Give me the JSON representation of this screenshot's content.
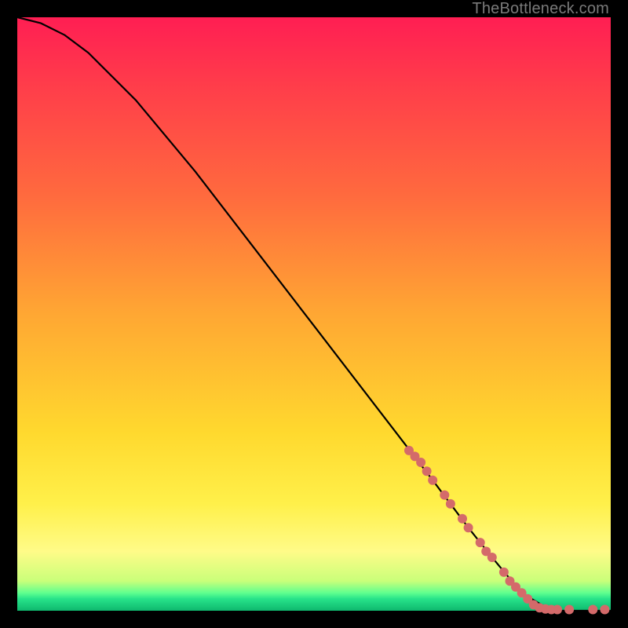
{
  "watermark": "TheBottleneck.com",
  "chart_data": {
    "type": "line",
    "title": "",
    "xlabel": "",
    "ylabel": "",
    "xlim": [
      0,
      100
    ],
    "ylim": [
      0,
      100
    ],
    "grid": false,
    "legend": false,
    "series": [
      {
        "name": "curve",
        "x": [
          0,
          4,
          8,
          12,
          16,
          20,
          30,
          40,
          50,
          60,
          70,
          76,
          80,
          85,
          90,
          95,
          100
        ],
        "y": [
          100,
          99,
          97,
          94,
          90,
          86,
          74,
          61,
          48,
          35,
          22,
          14,
          9,
          3,
          0,
          0,
          0
        ]
      }
    ],
    "markers": [
      {
        "x": 66,
        "y": 27
      },
      {
        "x": 67,
        "y": 26
      },
      {
        "x": 68,
        "y": 25
      },
      {
        "x": 69,
        "y": 23.5
      },
      {
        "x": 70,
        "y": 22
      },
      {
        "x": 72,
        "y": 19.5
      },
      {
        "x": 73,
        "y": 18
      },
      {
        "x": 75,
        "y": 15.5
      },
      {
        "x": 76,
        "y": 14
      },
      {
        "x": 78,
        "y": 11.5
      },
      {
        "x": 79,
        "y": 10
      },
      {
        "x": 80,
        "y": 9
      },
      {
        "x": 82,
        "y": 6.5
      },
      {
        "x": 83,
        "y": 5
      },
      {
        "x": 84,
        "y": 4
      },
      {
        "x": 85,
        "y": 3
      },
      {
        "x": 86,
        "y": 2
      },
      {
        "x": 87,
        "y": 1
      },
      {
        "x": 88,
        "y": 0.5
      },
      {
        "x": 89,
        "y": 0.3
      },
      {
        "x": 90,
        "y": 0.2
      },
      {
        "x": 91,
        "y": 0.2
      },
      {
        "x": 93,
        "y": 0.2
      },
      {
        "x": 97,
        "y": 0.2
      },
      {
        "x": 99,
        "y": 0.2
      }
    ]
  }
}
